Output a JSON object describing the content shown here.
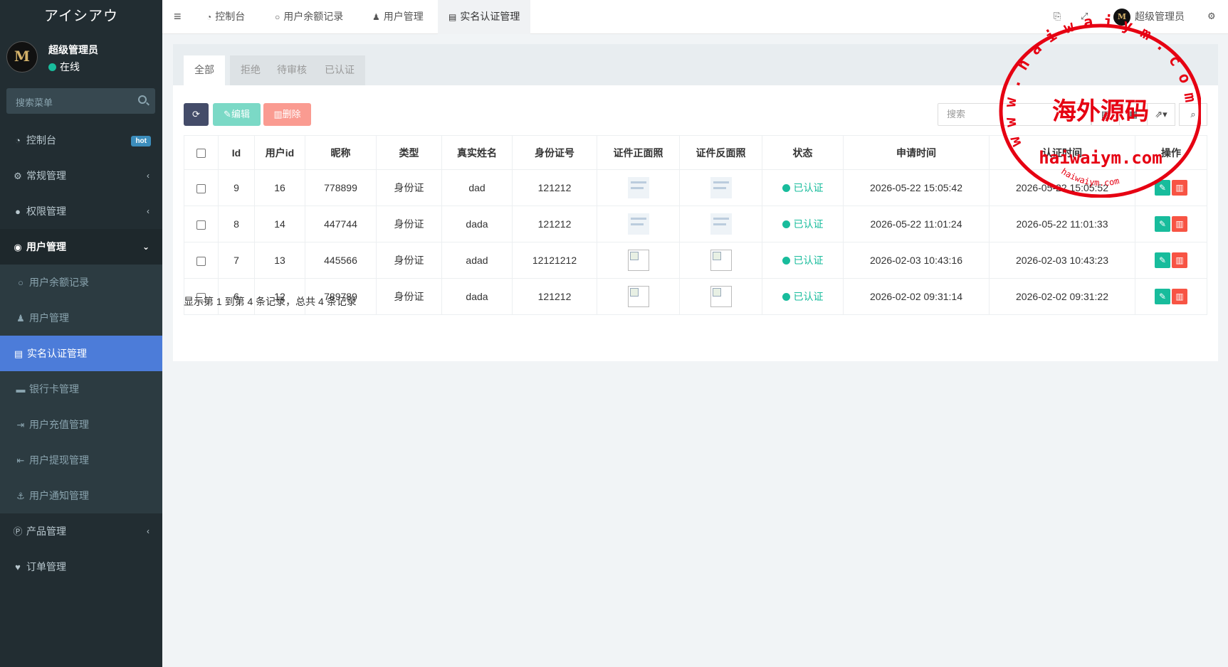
{
  "brand": "アイシアウ",
  "user": {
    "name": "超级管理员",
    "status": "在线",
    "avatar_text": "M"
  },
  "search_menu_placeholder": "搜索菜单",
  "menu": {
    "dashboard": "控制台",
    "hot": "hot",
    "general": "常规管理",
    "auth": "权限管理",
    "user_mgmt": "用户管理",
    "user_sub": [
      "用户余额记录",
      "用户管理",
      "实名认证管理",
      "银行卡管理",
      "用户充值管理",
      "用户提现管理",
      "用户通知管理"
    ],
    "product": "产品管理",
    "orders": "订单管理"
  },
  "topbar": {
    "tabs": [
      "控制台",
      "用户余额记录",
      "用户管理",
      "实名认证管理"
    ],
    "admin_name": "超级管理员"
  },
  "filter_tabs": [
    "全部",
    "拒绝",
    "待审核",
    "已认证"
  ],
  "toolbar": {
    "edit": "编辑",
    "delete": "删除",
    "search_placeholder": "搜索"
  },
  "table": {
    "headers": [
      "Id",
      "用户id",
      "昵称",
      "类型",
      "真实姓名",
      "身份证号",
      "证件正面照",
      "证件反面照",
      "状态",
      "申请时间",
      "认证时间",
      "操作"
    ],
    "rows": [
      {
        "id": "9",
        "uid": "16",
        "nick": "778899",
        "type": "身份证",
        "name": "dad",
        "idno": "121212",
        "status": "已认证",
        "apply": "2026-05-22 15:05:42",
        "verify": "2026-05-22 15:05:52"
      },
      {
        "id": "8",
        "uid": "14",
        "nick": "447744",
        "type": "身份证",
        "name": "dada",
        "idno": "121212",
        "status": "已认证",
        "apply": "2026-05-22 11:01:24",
        "verify": "2026-05-22 11:01:33"
      },
      {
        "id": "7",
        "uid": "13",
        "nick": "445566",
        "type": "身份证",
        "name": "adad",
        "idno": "12121212",
        "status": "已认证",
        "apply": "2026-02-03 10:43:16",
        "verify": "2026-02-03 10:43:23"
      },
      {
        "id": "6",
        "uid": "12",
        "nick": "789789",
        "type": "身份证",
        "name": "dada",
        "idno": "121212",
        "status": "已认证",
        "apply": "2026-02-02 09:31:14",
        "verify": "2026-02-02 09:31:22"
      }
    ]
  },
  "pagination_info": "显示第 1 到第 4 条记录，总共 4 条记录",
  "watermark": {
    "arc_top": "w w w . h a i w a i y m . c o m",
    "center": "海外源码",
    "domain": "haiwaiym.com",
    "arc_bottom": "haiwaiym.com"
  },
  "colors": {
    "sidebar_bg": "#222d32",
    "active_menu": "#4c7cd9",
    "success": "#18bc9c",
    "danger": "#f75444",
    "refresh_btn": "#444c69"
  }
}
